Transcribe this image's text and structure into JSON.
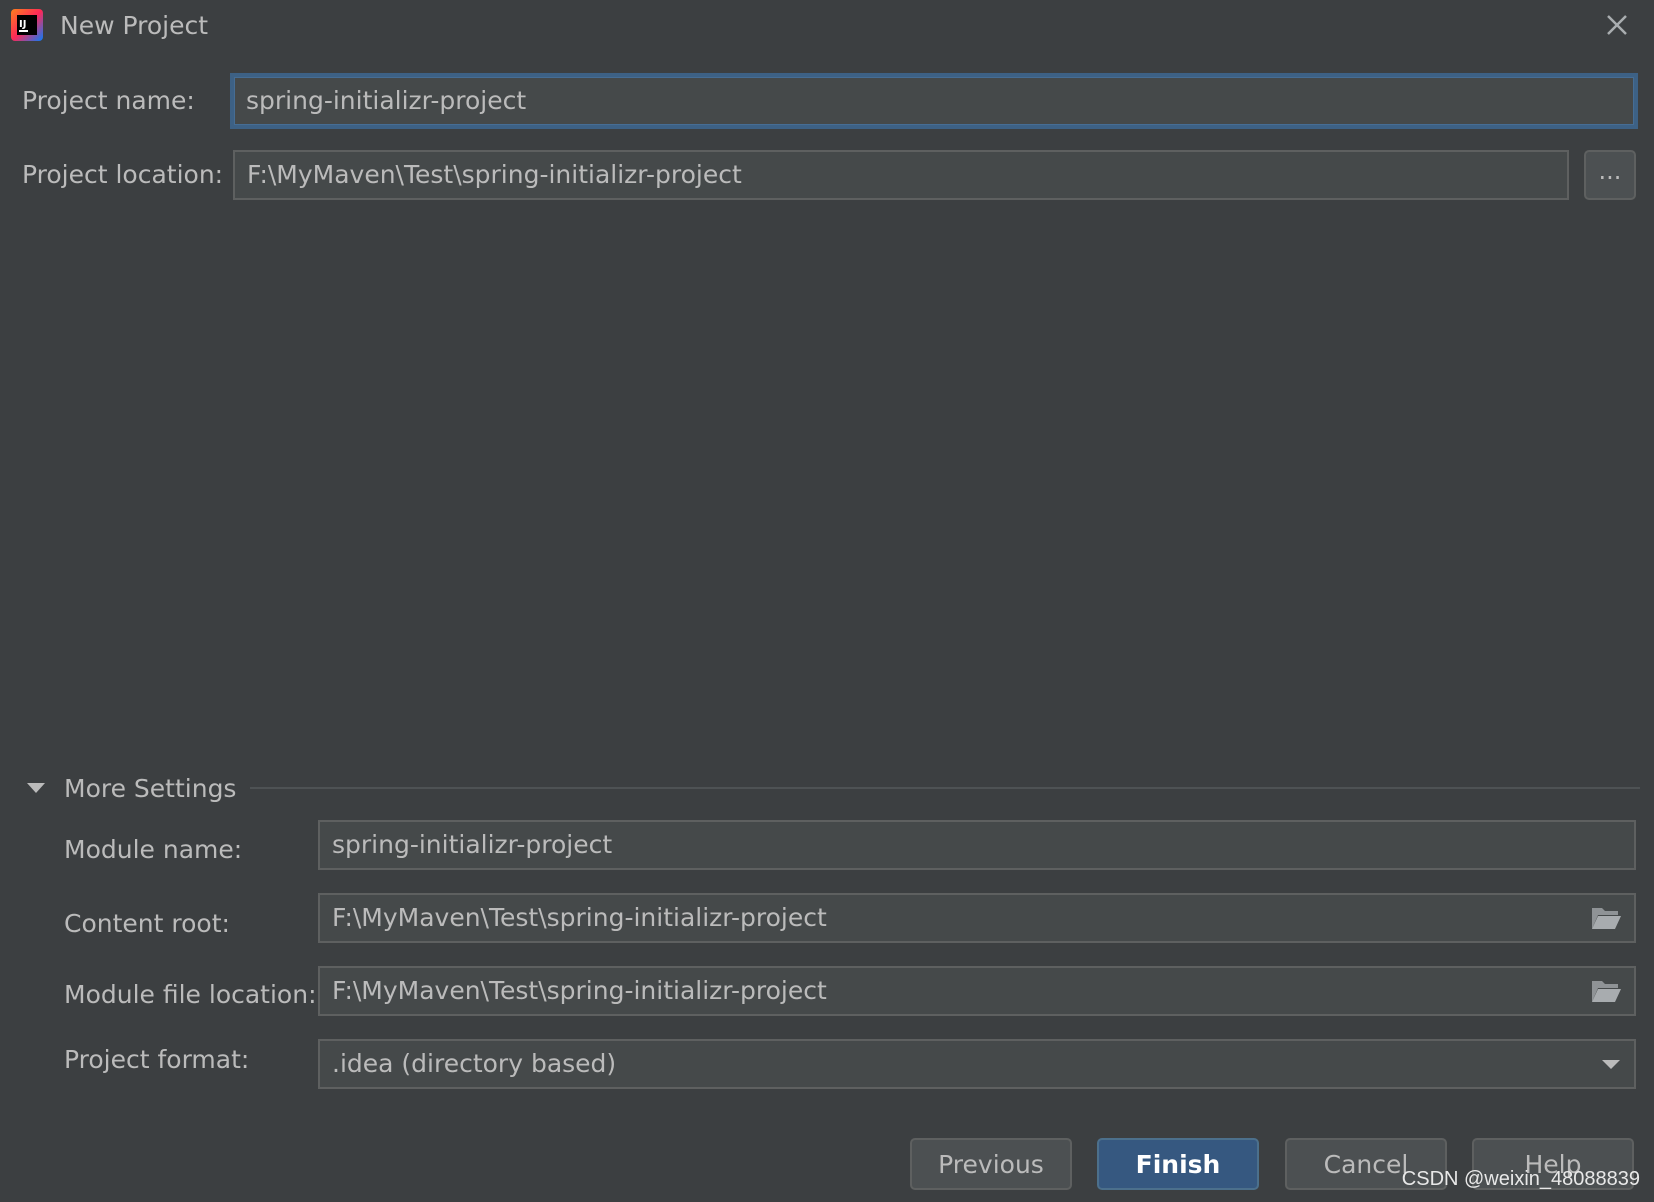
{
  "window": {
    "title": "New Project",
    "app_icon": "intellij-idea-icon",
    "close_icon": "close-icon"
  },
  "form": {
    "project_name_label": "Project name:",
    "project_name_value": "spring-initializr-project",
    "project_location_label": "Project location:",
    "project_location_value": "F:\\MyMaven\\Test\\spring-initializr-project",
    "browse_label": "..."
  },
  "more_settings": {
    "label": "More Settings",
    "expanded": true,
    "module_name_label": "Module name:",
    "module_name_value": "spring-initializr-project",
    "content_root_label": "Content root:",
    "content_root_value": "F:\\MyMaven\\Test\\spring-initializr-project",
    "module_file_location_label": "Module file location:",
    "module_file_location_value": "F:\\MyMaven\\Test\\spring-initializr-project",
    "project_format_label": "Project format:",
    "project_format_value": ".idea (directory based)"
  },
  "buttons": {
    "previous": "Previous",
    "finish": "Finish",
    "cancel": "Cancel",
    "help": "Help"
  },
  "watermark": "CSDN @weixin_48088839",
  "colors": {
    "background": "#3c3f41",
    "field": "#45494a",
    "focus_border": "#3d6185",
    "primary_button": "#365880",
    "text": "#bbbbbb"
  }
}
